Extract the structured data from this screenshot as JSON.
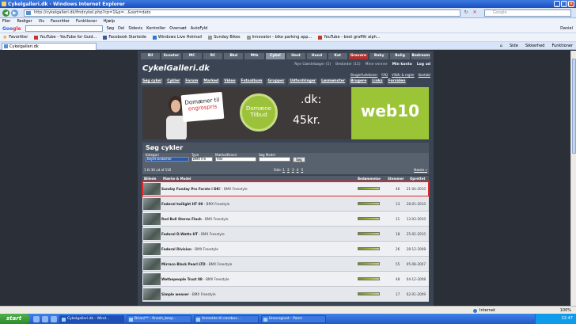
{
  "window": {
    "title": "Cykelgalleri.dk - Windows Internet Explorer"
  },
  "address": {
    "url": "http://cykelgalleri.dk/findcykel.php?cp=1&p=...&sort=dato"
  },
  "search_placeholder": "Google",
  "menu": [
    "Filer",
    "Rediger",
    "Vis",
    "Favoritter",
    "Funktioner",
    "Hjælp"
  ],
  "google_bar": {
    "logo_g": "Goo",
    "logo_rest": "gle",
    "items": [
      "Søg",
      "Del",
      "Sidevis",
      "Kontroller",
      "Oversæt",
      "AutoFyld"
    ],
    "user": "Daniel"
  },
  "favorites": {
    "label": "Favoritter",
    "items": [
      "YouTube - YouTube for Guid...",
      "Facebook Startside",
      "Windows Live Hotmail",
      "Sunday Bikes",
      "Innovator - bike parking app...",
      "YouTube - best graffiti alph..."
    ],
    "right_tools": [
      "Side",
      "Sikkerhed",
      "Funktioner"
    ]
  },
  "tab": {
    "label": "Cykelgalleri.dk"
  },
  "site": {
    "categories": [
      "Bil",
      "Scooter",
      "MC",
      "RC",
      "Bkd",
      "Mtb",
      "Cykel",
      "Hest",
      "Hund",
      "Kat",
      "Gravere",
      "Baby",
      "Bolig",
      "Bedroom"
    ],
    "logo": "CykelGalleri.dk",
    "userbar": {
      "newest": "Nye Gæstebøger (5)",
      "messages": "Beskeder (15)",
      "friends": "Mine venner",
      "profile": "Min konto",
      "logout": "Log ud"
    },
    "toplinks": [
      "Brugerfunktioner",
      "FAQ",
      "Vilkår & regler",
      "Kontakt"
    ],
    "mainnav": [
      "Søg cykel",
      "Cykler",
      "Forum",
      "Marked",
      "Video",
      "Fotoalbum",
      "Grupper",
      "Udfordringer",
      "Løsmønster",
      "Brugere",
      "Links",
      "Forsiden"
    ],
    "banner": {
      "sign_line1": "Domæner til",
      "sign_line2": "engrospris",
      "circle": "Domæne Tilbud",
      "dk": ".dk:",
      "price": "45kr.",
      "web10": "web10"
    },
    "search": {
      "heading": "Søg cykler",
      "labels": [
        "Kategori",
        "Type",
        "Mærke/Brand",
        "Søg Model"
      ],
      "fields": [
        "Bejlet bedømte",
        "BMX Fre",
        "Alle",
        ""
      ],
      "button": "Søg"
    },
    "results": {
      "count": "1 til 30 ud af 116",
      "pages_label": "Side:",
      "pages": [
        "1",
        "2",
        "3",
        "4",
        "5"
      ],
      "next": "Næste »"
    },
    "table": {
      "headers": [
        "Billede",
        "Mærke & Model",
        "Bedømmelse",
        "Stemmer",
        "Oprettet"
      ],
      "rows": [
        {
          "name": "Sunday Funday Pro Forste i DK!",
          "type": "BMX Freestyle",
          "votes": "46",
          "date": "21-04-2010",
          "rating": 0.9
        },
        {
          "name": "Federal twilight HT 09",
          "type": "BMX Freestyle",
          "votes": "13",
          "date": "28-01-2010",
          "rating": 0.85
        },
        {
          "name": "Red Bull Stereo Flash",
          "type": "BMX Freestyle",
          "votes": "11",
          "date": "13-03-2010",
          "rating": 0.85
        },
        {
          "name": "Federal D.Watts HT",
          "type": "BMX Freestyle",
          "votes": "18",
          "date": "25-02-2010",
          "rating": 0.85
        },
        {
          "name": "Federal Division",
          "type": "BMX Freestyle",
          "votes": "26",
          "date": "28-12-2008",
          "rating": 0.85
        },
        {
          "name": "Mirraco Black Pearl LTD",
          "type": "BMX Freestyle",
          "votes": "55",
          "date": "05-08-2007",
          "rating": 0.85
        },
        {
          "name": "Wethepeople Trust 08",
          "type": "BMX Freestyle",
          "votes": "48",
          "date": "04-12-2008",
          "rating": 0.85
        },
        {
          "name": "Simple weaver",
          "type": "BMX Freestyle",
          "votes": "17",
          "date": "02-01-2009",
          "rating": 0.85
        }
      ]
    }
  },
  "status": {
    "zone": "Internet",
    "zoom": "100%"
  },
  "taskbar": {
    "start": "start",
    "tasks": [
      "Cykelgalleri.dk - Wind...",
      "Brian/** - finesh_besp...",
      "Anmelde til cambus...",
      "Unavngivet - Paint"
    ],
    "clock": "22:47"
  }
}
